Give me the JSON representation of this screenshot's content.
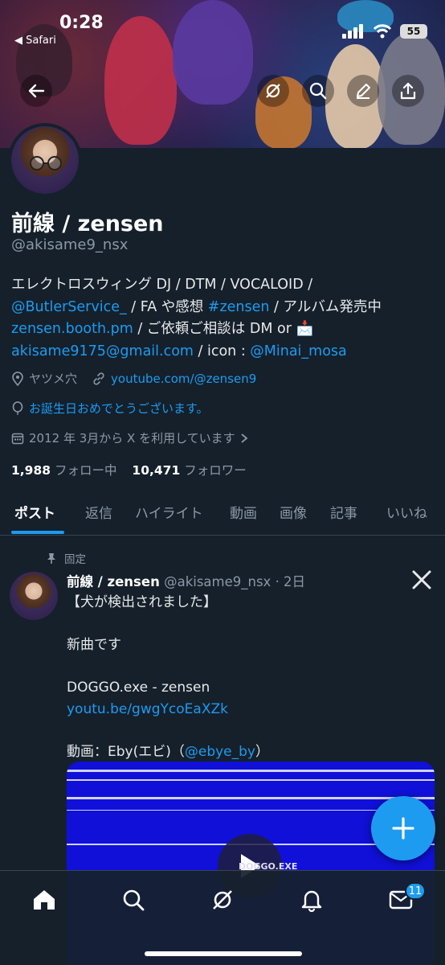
{
  "status_bar": {
    "time": "0:28",
    "back_app": "◀ Safari",
    "battery": "55"
  },
  "profile": {
    "name": "前線 / zensen",
    "handle": "@akisame9_nsx",
    "bio": [
      [
        {
          "t": "エレクトロスウィング DJ / DTM / VOCALOID /",
          "l": false
        }
      ],
      [
        {
          "t": "@ButlerService_",
          "l": true
        },
        {
          "t": " / FA や感想 ",
          "l": false
        },
        {
          "t": "#zensen",
          "l": true
        },
        {
          "t": " / アルバム発売中",
          "l": false
        }
      ],
      [
        {
          "t": "zensen.booth.pm",
          "l": true
        },
        {
          "t": " / ご依頼ご相談は DM or 📩",
          "l": false
        }
      ],
      [
        {
          "t": "akisame9175@gmail.com",
          "l": true
        },
        {
          "t": " / icon : ",
          "l": false
        },
        {
          "t": "@Minai_mosa",
          "l": true
        }
      ]
    ],
    "location": "ヤツメ穴",
    "website": "youtube.com/@zensen9",
    "birthday": "お誕生日おめでとうございます。",
    "joined": "2012 年 3月から X を利用しています",
    "following_count": "1,988",
    "following_label": "フォロー中",
    "followers_count": "10,471",
    "followers_label": "フォロワー"
  },
  "tabs": [
    "ポスト",
    "返信",
    "ハイライト",
    "動画",
    "画像",
    "記事",
    "いいね"
  ],
  "post": {
    "pinned_label": "固定",
    "author": "前線 / zensen",
    "handle_time": "@akisame9_nsx · 2日",
    "lines": [
      "【犬が検出されました】",
      "",
      "新曲です",
      "",
      "DOGGO.exe - zensen"
    ],
    "link": "youtu.be/gwgYcoEaXZk",
    "credit_prefix": "動画：Eby(エビ)（",
    "credit_link": "@ebye_by",
    "credit_suffix": "）",
    "media_caption": "DOGGO.EXE"
  },
  "nav": {
    "messages_badge": "11"
  },
  "colors": {
    "background": "#15202b",
    "accent": "#1d9bf0",
    "muted": "#8b98a5"
  }
}
